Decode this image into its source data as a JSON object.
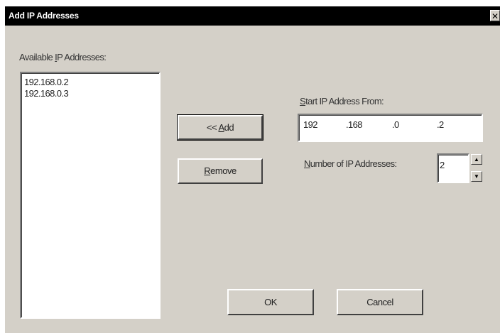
{
  "window": {
    "title": "Add IP Addresses",
    "close_glyph": "✕"
  },
  "available": {
    "label_pre": "Available ",
    "label_accel": "I",
    "label_post": "P Addresses:",
    "items": [
      "192.168.0.2",
      "192.168.0.3"
    ]
  },
  "buttons": {
    "add_pre": "<< ",
    "add_accel": "A",
    "add_post": "dd",
    "remove_accel": "R",
    "remove_post": "emove",
    "ok": "OK",
    "cancel": "Cancel"
  },
  "start_ip": {
    "label_accel": "S",
    "label_post": "tart IP Address From:",
    "octets": [
      "192",
      ".168",
      ".0",
      ".2"
    ]
  },
  "count": {
    "label_accel": "N",
    "label_post": "umber of IP Addresses:",
    "value": "2",
    "up_glyph": "▲",
    "down_glyph": "▼"
  }
}
